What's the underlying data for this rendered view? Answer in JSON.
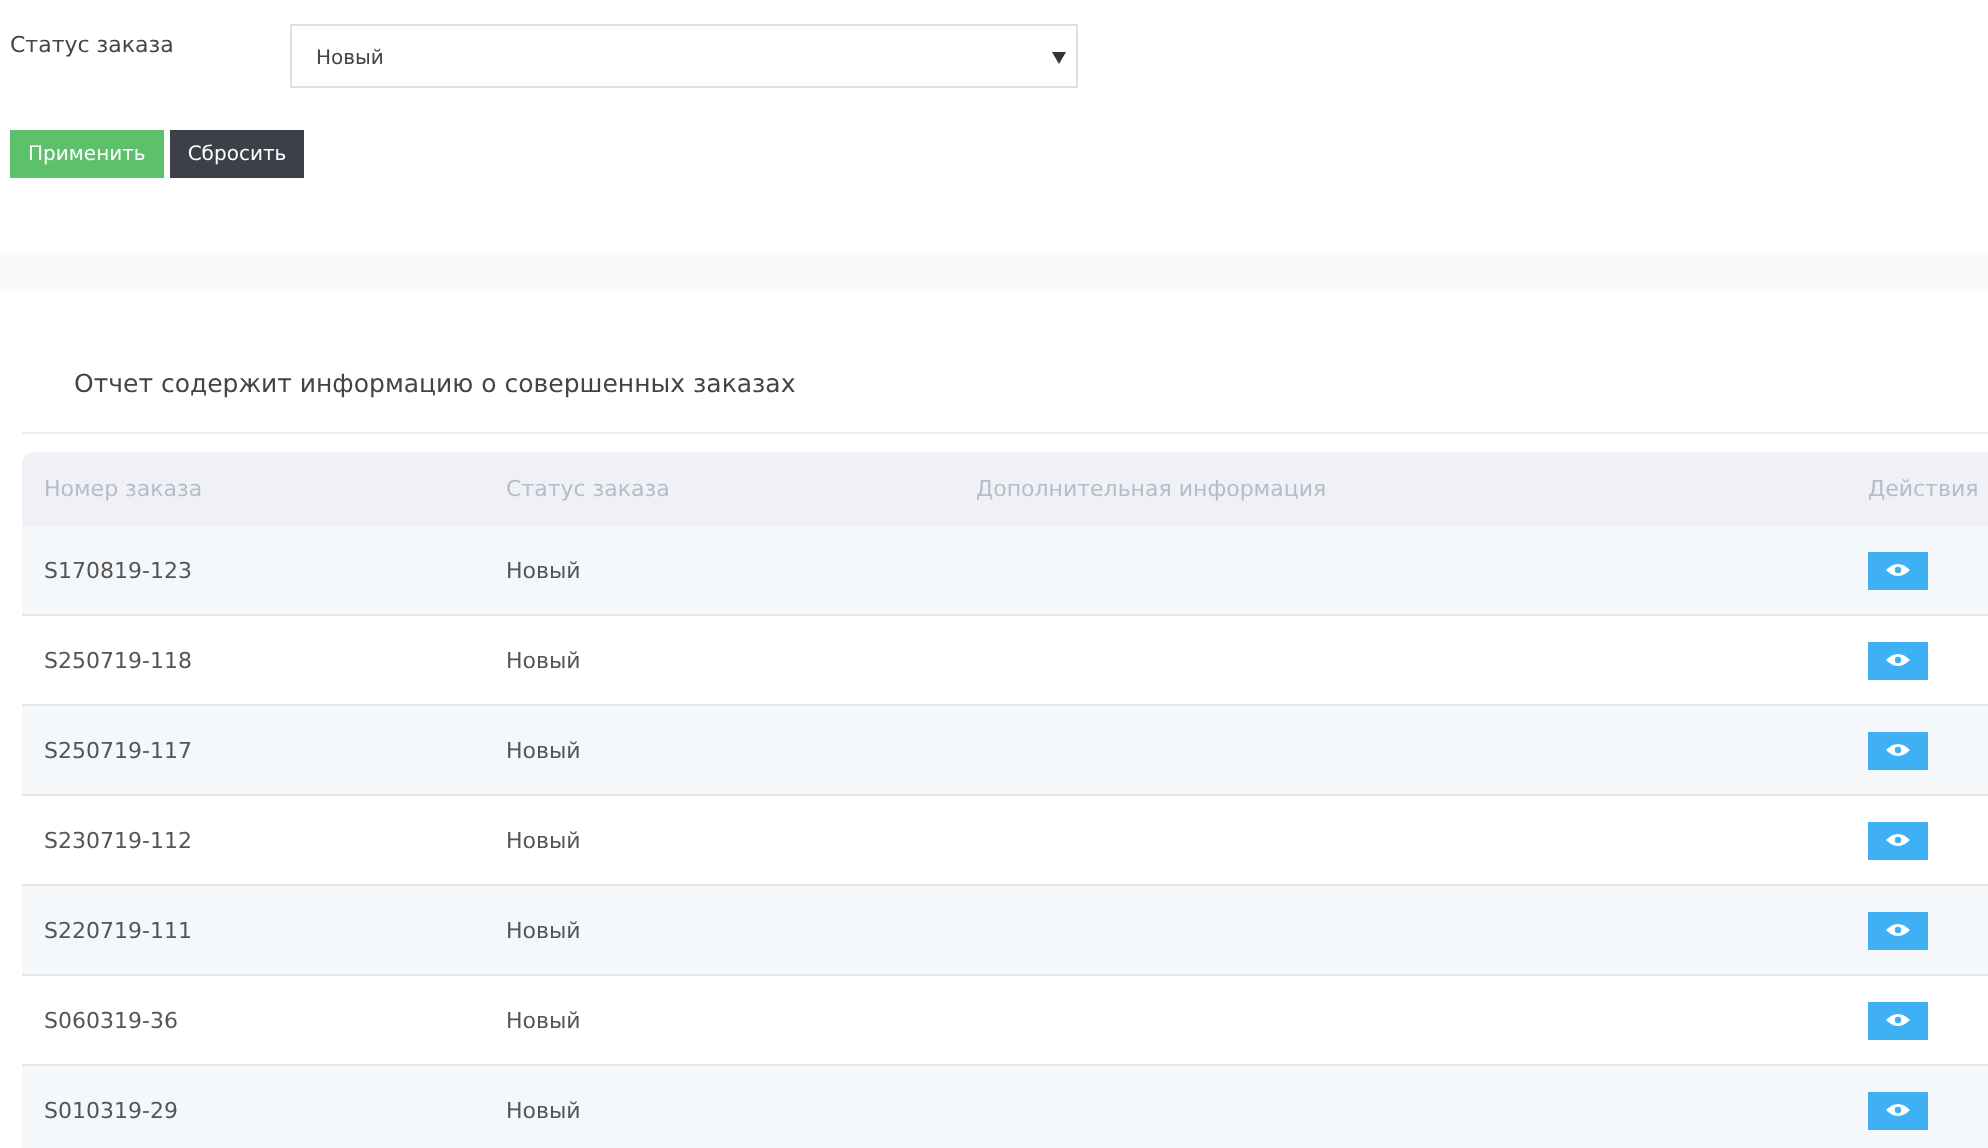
{
  "filter": {
    "label": "Статус заказа",
    "value": "Новый"
  },
  "buttons": [
    {
      "label": "Применить",
      "kind": "primary"
    },
    {
      "label": "Сбросить",
      "kind": "dark"
    }
  ],
  "report": {
    "title": "Отчет содержит информацию о совершенных заказах",
    "columns": [
      "Номер заказа",
      "Статус заказа",
      "Дополнительная информация",
      "Действия"
    ],
    "rows": [
      {
        "number": "S170819-123",
        "status": "Новый"
      },
      {
        "number": "S250719-118",
        "status": "Новый"
      },
      {
        "number": "S250719-117",
        "status": "Новый"
      },
      {
        "number": "S230719-112",
        "status": "Новый"
      },
      {
        "number": "S220719-111",
        "status": "Новый"
      },
      {
        "number": "S060319-36",
        "status": "Новый"
      },
      {
        "number": "S010319-29",
        "status": "Новый"
      }
    ]
  }
}
